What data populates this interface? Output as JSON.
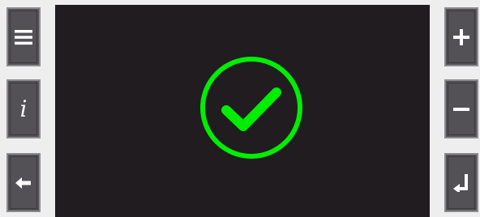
{
  "left_buttons": [
    {
      "name": "menu",
      "icon": "menu-icon"
    },
    {
      "name": "info",
      "icon": "info-icon",
      "glyph": "i"
    },
    {
      "name": "back",
      "icon": "arrow-left-icon"
    }
  ],
  "right_buttons": [
    {
      "name": "increase",
      "icon": "plus-icon"
    },
    {
      "name": "decrease",
      "icon": "minus-icon"
    },
    {
      "name": "enter",
      "icon": "enter-icon"
    }
  ],
  "status": {
    "icon": "check-circle-icon",
    "color": "#00ee00"
  },
  "colors": {
    "background": "#eeeeef",
    "button": "#535155",
    "screen": "#201c20",
    "icon": "#ffffff"
  }
}
